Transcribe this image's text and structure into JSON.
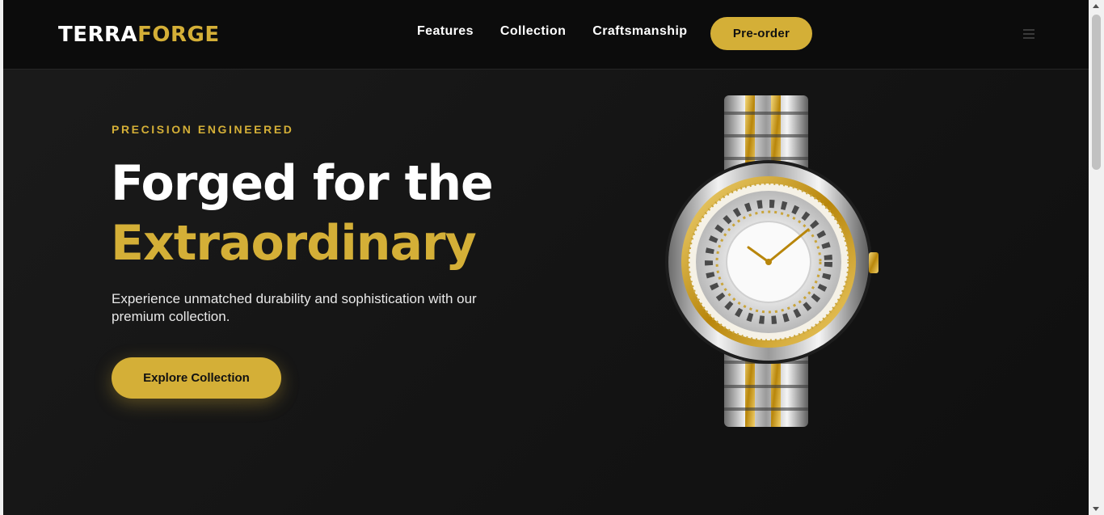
{
  "brand": {
    "part1": "TERRA",
    "part2": "FORGE"
  },
  "nav": {
    "links": [
      {
        "label": "Features"
      },
      {
        "label": "Collection"
      },
      {
        "label": "Craftsmanship"
      }
    ],
    "cta_label": "Pre-order",
    "menu_icon": "hamburger-icon"
  },
  "hero": {
    "eyebrow": "PRECISION ENGINEERED",
    "headline_line1": "Forged for the",
    "headline_line2": "Extraordinary",
    "subtitle": "Experience unmatched durability and sophistication with our premium collection.",
    "cta_label": "Explore Collection",
    "image_subject": "gold-and-silver-luxury-watch"
  },
  "colors": {
    "accent": "#d4af37",
    "background": "#141414",
    "navbar": "#0c0c0c",
    "text": "#ffffff"
  }
}
